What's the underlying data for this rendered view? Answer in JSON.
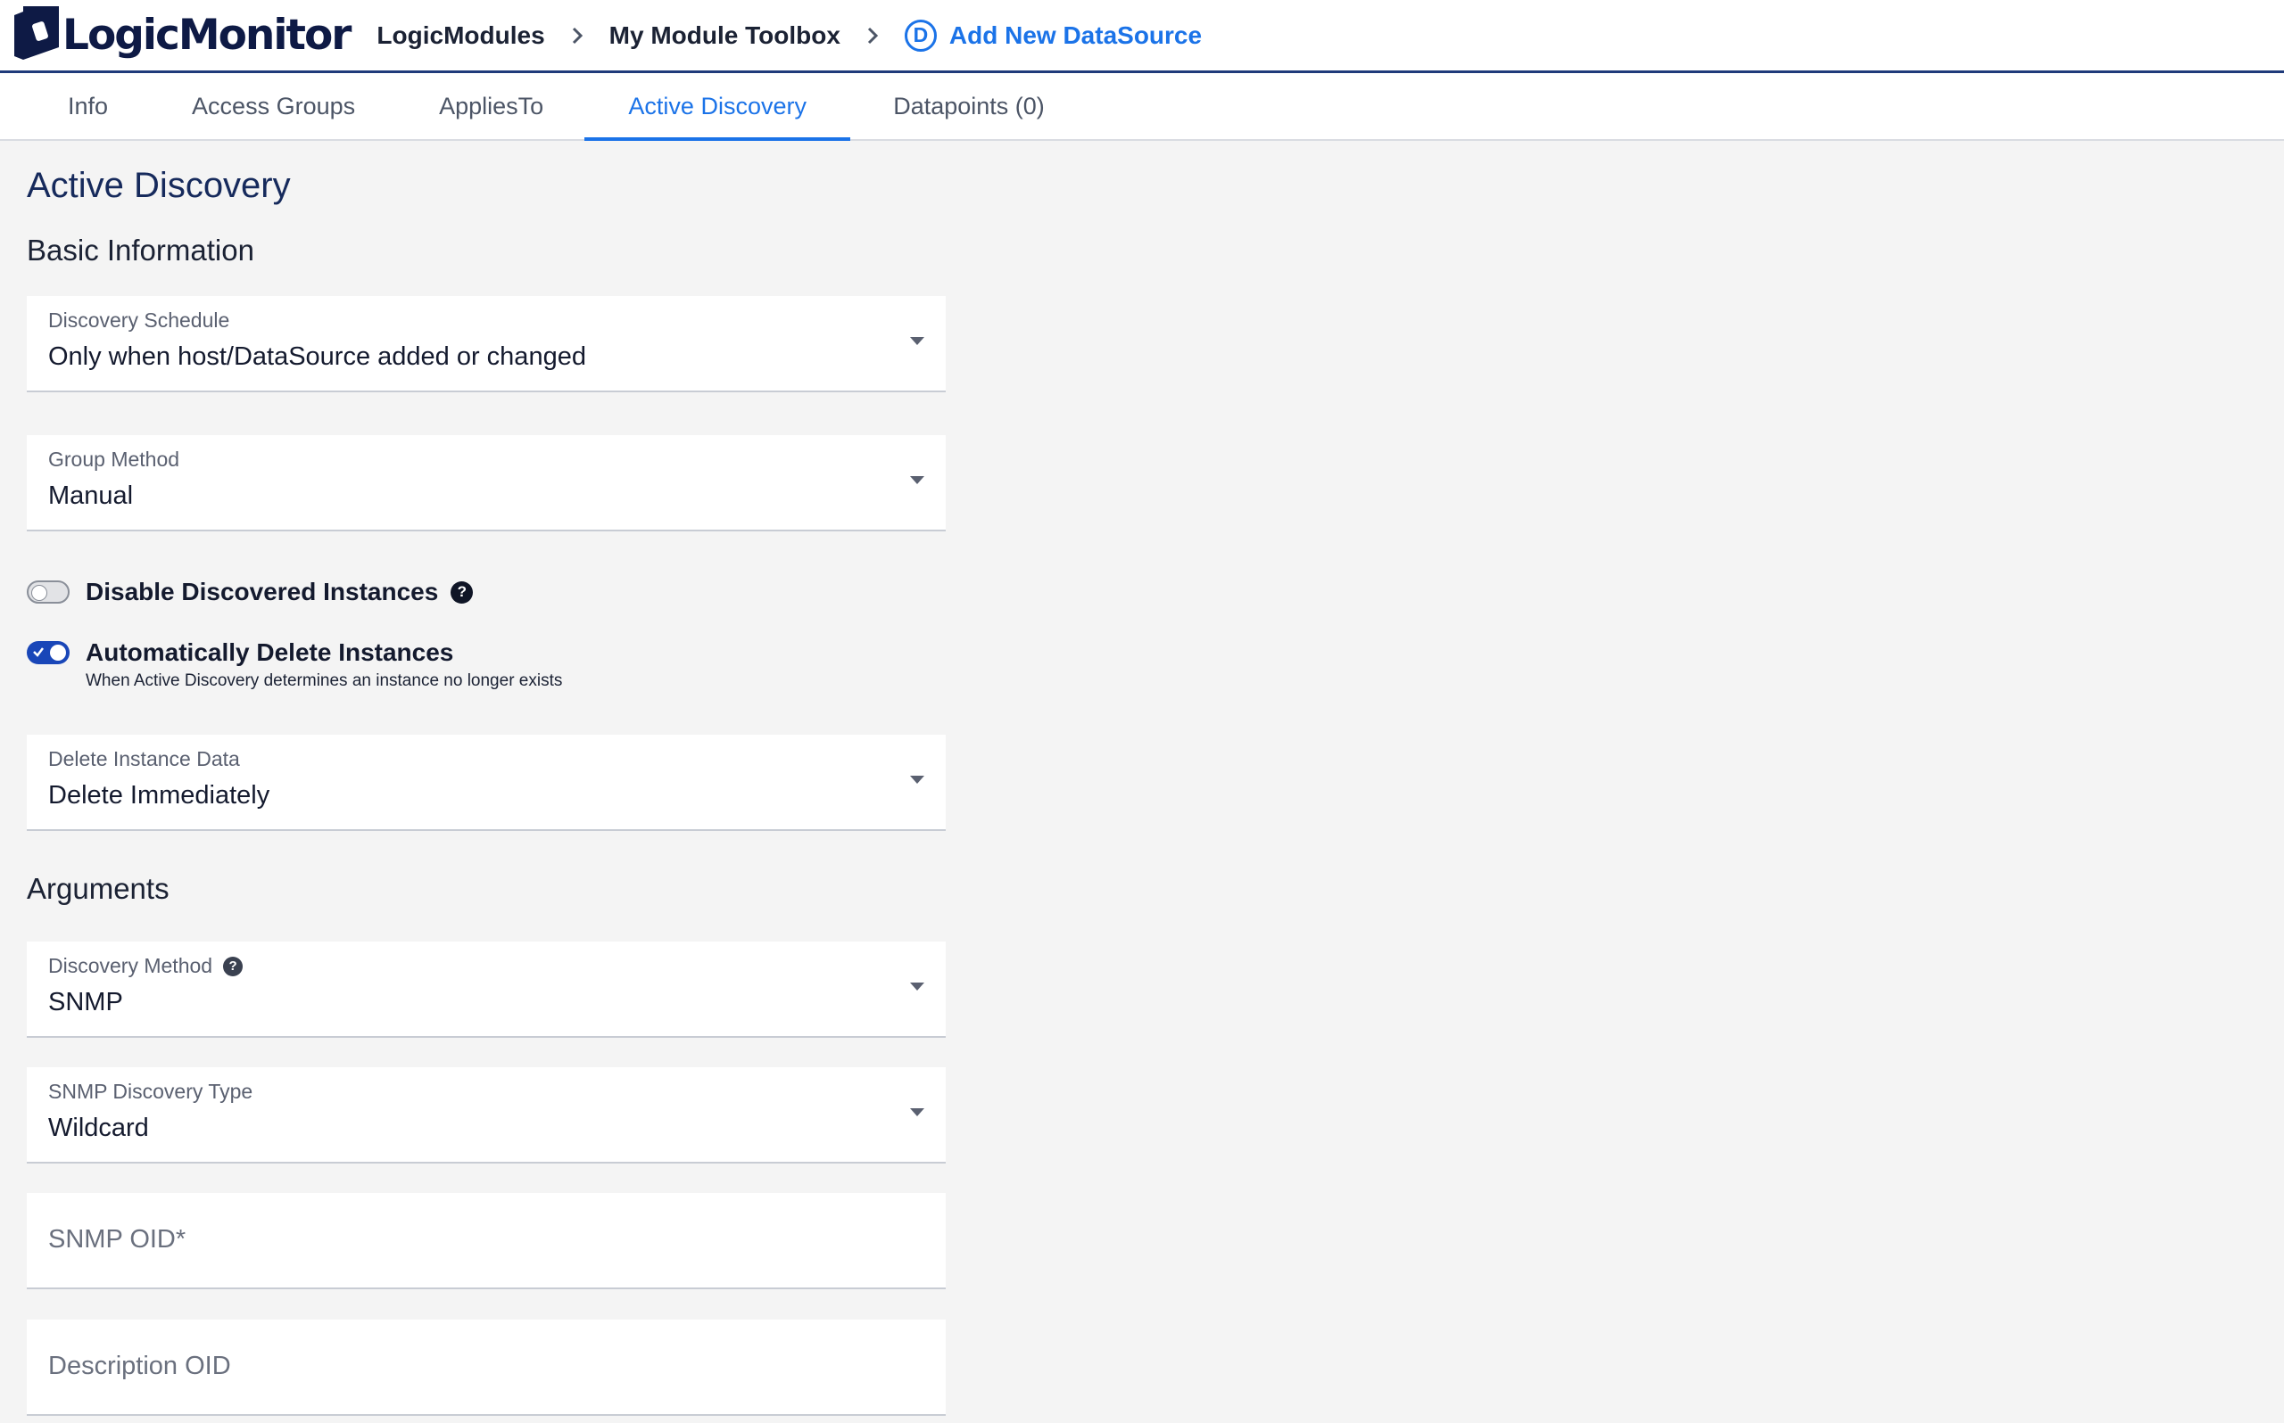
{
  "app": {
    "brand": "LogicMonitor"
  },
  "breadcrumb": {
    "items": [
      "LogicModules",
      "My Module Toolbox"
    ],
    "current_badge": "D",
    "current": "Add New DataSource"
  },
  "tabs": [
    {
      "label": "Info",
      "active": false
    },
    {
      "label": "Access Groups",
      "active": false
    },
    {
      "label": "AppliesTo",
      "active": false
    },
    {
      "label": "Active Discovery",
      "active": true
    },
    {
      "label": "Datapoints (0)",
      "active": false
    }
  ],
  "page": {
    "title": "Active Discovery"
  },
  "basic_info": {
    "title": "Basic Information",
    "discovery_schedule": {
      "label": "Discovery Schedule",
      "value": "Only when host/DataSource added or changed"
    },
    "group_method": {
      "label": "Group Method",
      "value": "Manual"
    },
    "disable_discovered": {
      "label": "Disable Discovered Instances",
      "enabled": false
    },
    "auto_delete": {
      "label": "Automatically Delete Instances",
      "hint": "When Active Discovery determines an instance no longer exists",
      "enabled": true
    },
    "delete_instance_data": {
      "label": "Delete Instance Data",
      "value": "Delete Immediately"
    }
  },
  "arguments": {
    "title": "Arguments",
    "discovery_method": {
      "label": "Discovery Method",
      "value": "SNMP"
    },
    "snmp_discovery_type": {
      "label": "SNMP Discovery Type",
      "value": "Wildcard"
    },
    "snmp_oid": {
      "placeholder": "SNMP OID*"
    },
    "description_oid": {
      "placeholder": "Description OID"
    }
  },
  "colors": {
    "brand_navy": "#0e1a45",
    "accent_blue": "#1b73e8",
    "toggle_on": "#1946b8",
    "background": "#f4f4f4"
  },
  "icons": {
    "logo": "logicmonitor-logo-icon",
    "breadcrumb_separator": "chevron-right-icon",
    "dropdown": "caret-down-icon",
    "help": "question-circle-icon"
  }
}
